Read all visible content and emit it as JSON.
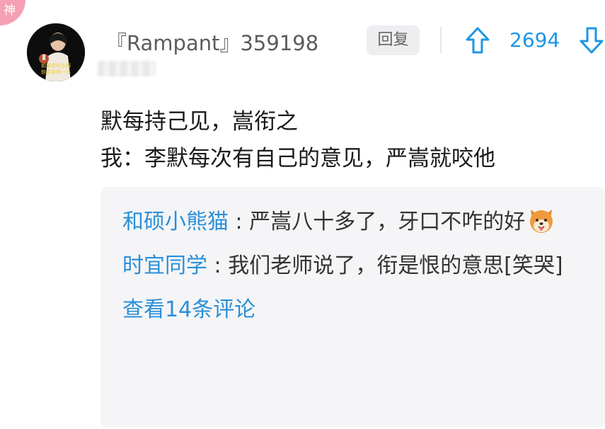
{
  "badge": {
    "label": "神"
  },
  "comment": {
    "username": "『Rampant』359198",
    "avatar_caption_line1": "如果是你衣服",
    "avatar_caption_line2": "你要穿哪一件",
    "reply_label": "回复",
    "vote_count": "2694",
    "lines": [
      "默每持己见，嵩衔之",
      "我：李默每次有自己的意见，严嵩就咬他"
    ]
  },
  "replies": [
    {
      "author": "和硕小熊猫",
      "separator": ":",
      "text": "严嵩八十多了，牙口不咋的好",
      "emoji": "shiba-dog-emoji"
    },
    {
      "author": "时宜同学",
      "separator": ":",
      "text": "我们老师说了，衔是恨的意思[笑哭]"
    }
  ],
  "view_more_label": "查看14条评论",
  "colors": {
    "accent_blue": "#1c95e6",
    "reply_author_blue": "#2a8fd8",
    "badge_pink": "#f5a0b4",
    "reply_bg": "#f5f5f7"
  }
}
